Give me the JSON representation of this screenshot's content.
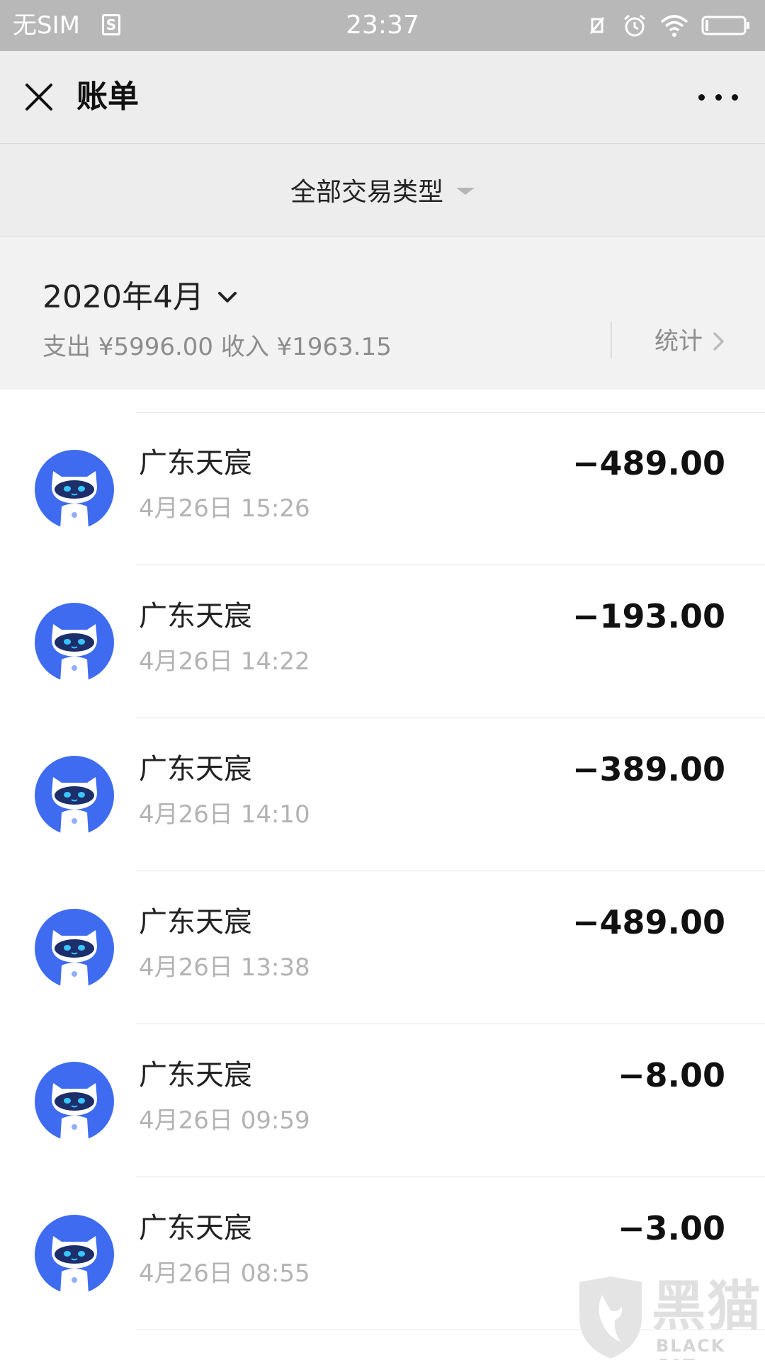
{
  "status_bar": {
    "carrier": "无SIM",
    "sim_icon": "S",
    "time": "23:37",
    "icons": [
      "vibrate-off-icon",
      "alarm-icon",
      "wifi-icon",
      "battery-icon"
    ]
  },
  "header": {
    "title": "账单",
    "close_icon": "close-icon",
    "more_icon": "more-icon"
  },
  "filter": {
    "label": "全部交易类型"
  },
  "summary": {
    "month": "2020年4月",
    "totals": "支出 ¥5996.00 收入 ¥1963.15",
    "stats_label": "统计"
  },
  "transactions": [
    {
      "merchant": "广东天宸",
      "datetime": "4月26日 15:26",
      "amount": "−489.00"
    },
    {
      "merchant": "广东天宸",
      "datetime": "4月26日 14:22",
      "amount": "−193.00"
    },
    {
      "merchant": "广东天宸",
      "datetime": "4月26日 14:10",
      "amount": "−389.00"
    },
    {
      "merchant": "广东天宸",
      "datetime": "4月26日 13:38",
      "amount": "−489.00"
    },
    {
      "merchant": "广东天宸",
      "datetime": "4月26日 09:59",
      "amount": "−8.00"
    },
    {
      "merchant": "广东天宸",
      "datetime": "4月26日 08:55",
      "amount": "−3.00"
    }
  ],
  "watermark": {
    "title": "黑猫",
    "subtitle": "BLACK CAT"
  },
  "colors": {
    "status_bar_bg": "#b8b8b8",
    "header_bg": "#ededed",
    "summary_bg": "#f2f2f2",
    "avatar_blue": "#3e6bf0",
    "secondary_text": "#b3b3b3"
  }
}
